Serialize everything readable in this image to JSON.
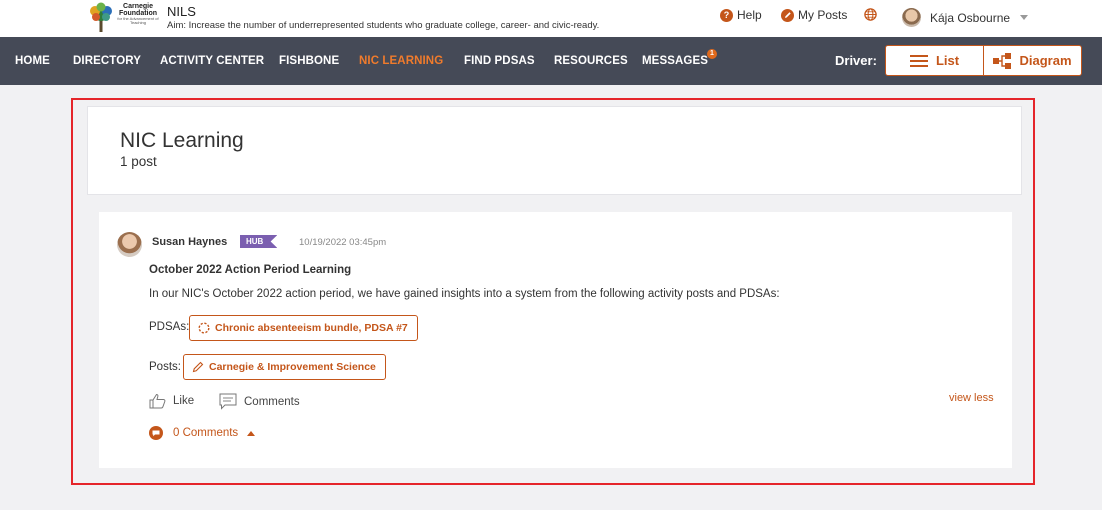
{
  "header": {
    "logo": {
      "line1": "Carnegie",
      "line2": "Foundation",
      "line3": "for the Advancement of Teaching"
    },
    "app_title": "NILS",
    "aim": "Aim:  Increase the number of underrepresented students who graduate college, career- and civic-ready.",
    "help_label": "Help",
    "my_posts_label": "My Posts",
    "user_name": "Kája Osbourne"
  },
  "nav": {
    "items": [
      "HOME",
      "DIRECTORY",
      "ACTIVITY CENTER",
      "FISHBONE",
      "NIC LEARNING",
      "FIND PDSAS",
      "RESOURCES",
      "MESSAGES"
    ],
    "active": "NIC LEARNING",
    "messages_badge": "1",
    "driver_label": "Driver:",
    "list_label": "List",
    "diagram_label": "Diagram"
  },
  "page": {
    "title": "NIC Learning",
    "count": "1 post"
  },
  "post": {
    "author": "Susan Haynes",
    "badge": "HUB",
    "date": "10/19/2022 03:45pm",
    "title": "October 2022 Action Period Learning",
    "body": "In our NIC's October 2022 action period, we have gained insights into a system from the following activity posts and PDSAs:",
    "pdsas_label": "PDSAs:",
    "pdsa_link": "Chronic absenteeism bundle, PDSA #7",
    "posts_label": "Posts:",
    "post_link": "Carnegie & Improvement Science",
    "like_label": "Like",
    "comments_label": "Comments",
    "view_less": "view less",
    "comments_count": "0 Comments"
  },
  "colors": {
    "accent": "#c4561a",
    "nav_bg": "#454a57",
    "active_nav": "#f07b2c",
    "hub_badge": "#7b5fb0",
    "highlight": "#e5252a"
  }
}
